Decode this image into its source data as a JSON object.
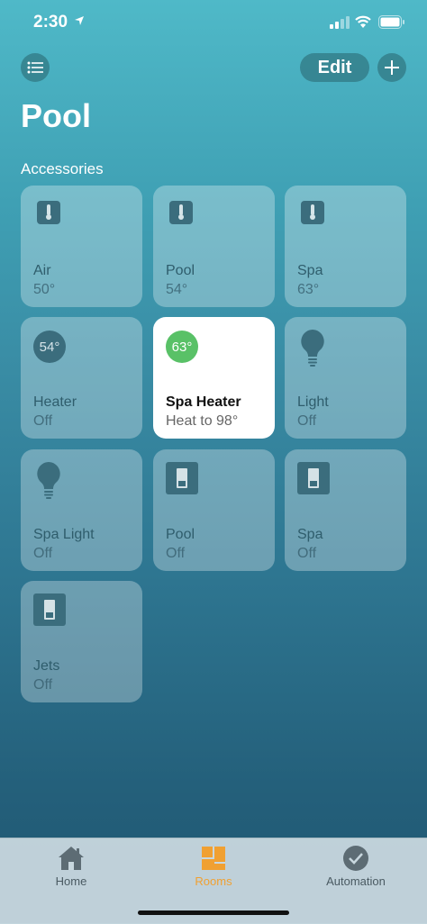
{
  "status": {
    "time": "2:30"
  },
  "header": {
    "edit_label": "Edit",
    "title": "Pool",
    "section": "Accessories"
  },
  "accessories": [
    {
      "name": "Air",
      "status": "50°",
      "icon": "thermometer-icon"
    },
    {
      "name": "Pool",
      "status": "54°",
      "icon": "thermometer-icon"
    },
    {
      "name": "Spa",
      "status": "63°",
      "icon": "thermometer-icon"
    },
    {
      "name": "Heater",
      "status": "Off",
      "icon": "thermostat-icon",
      "badge": "54°"
    },
    {
      "name": "Spa Heater",
      "status": "Heat to 98°",
      "icon": "thermostat-icon",
      "badge": "63°",
      "active": true
    },
    {
      "name": "Light",
      "status": "Off",
      "icon": "lightbulb-icon"
    },
    {
      "name": "Spa Light",
      "status": "Off",
      "icon": "lightbulb-icon"
    },
    {
      "name": "Pool",
      "status": "Off",
      "icon": "switch-icon"
    },
    {
      "name": "Spa",
      "status": "Off",
      "icon": "switch-icon"
    },
    {
      "name": "Jets",
      "status": "Off",
      "icon": "switch-icon"
    }
  ],
  "tabs": [
    {
      "label": "Home",
      "icon": "house-icon"
    },
    {
      "label": "Rooms",
      "icon": "rooms-icon",
      "selected": true
    },
    {
      "label": "Automation",
      "icon": "automation-icon"
    }
  ],
  "colors": {
    "accent": "#f0a032",
    "active_green": "#59c167"
  }
}
